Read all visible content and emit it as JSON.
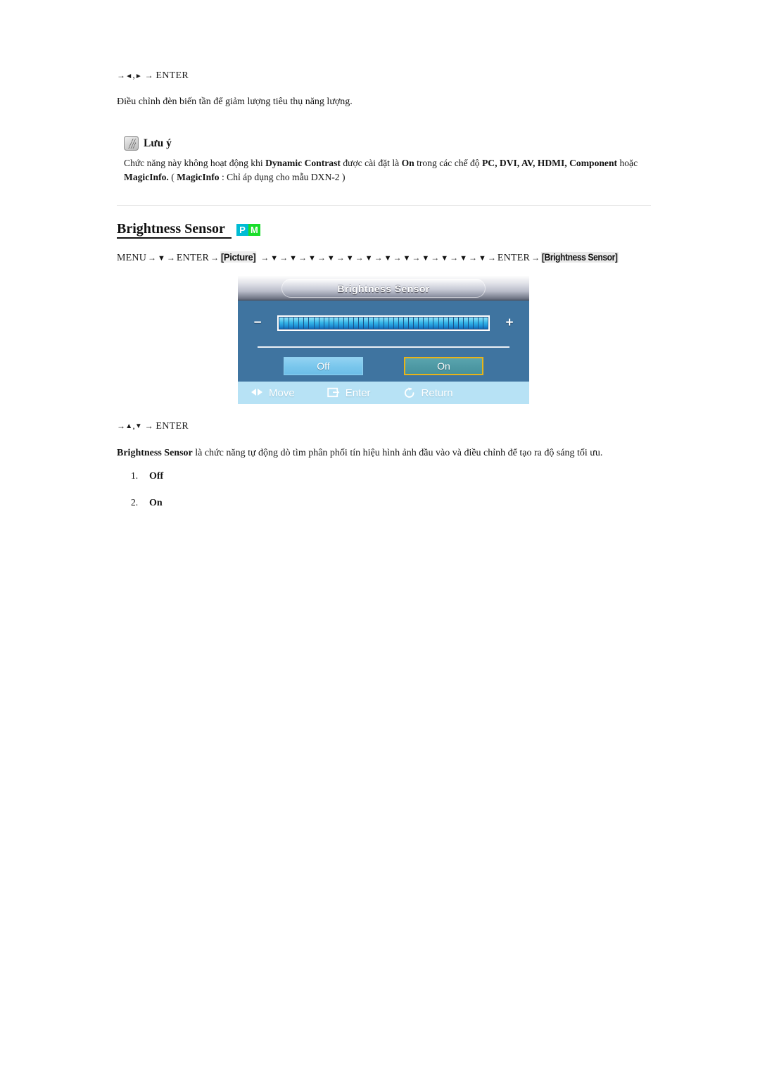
{
  "top_key_sequence": {
    "prefix_arrow": "→",
    "keys": [
      "◄",
      "►"
    ],
    "separator": ",",
    "arrow": "→",
    "enter": "ENTER"
  },
  "intro_paragraph": "Điều chỉnh đèn biến tần để giảm lượng tiêu thụ năng lượng.",
  "note": {
    "icon": "note-pen-icon",
    "title": "Lưu ý",
    "line1_part1": "Chức năng này không hoạt động khi ",
    "line1_bold1": "Dynamic Contrast",
    "line1_part2": " được cài đặt là ",
    "line1_bold2": "On",
    "line1_part3": " trong các chế độ ",
    "line1_bold3": "PC, DVI, AV, HDMI, Component",
    "line1_part4": " hoặc",
    "line2_bold1": "MagicInfo.",
    "line2_part1": " ( ",
    "line2_bold2": "MagicInfo",
    "line2_part2": " : Chỉ áp dụng cho mẫu DXN-2 )"
  },
  "section": {
    "heading": "Brightness Sensor",
    "badges": [
      {
        "label": "P",
        "color": "#00bcd4",
        "name": "badge-picture"
      },
      {
        "label": "M",
        "color": "#19dd2a",
        "name": "badge-magicinfo"
      }
    ]
  },
  "key_path": {
    "menu": "MENU",
    "arrow": "→",
    "down": "▼",
    "enter": "ENTER",
    "picture_chip": "[Picture]",
    "target_chip": "[Brightness Sensor]",
    "downs_before_enter_1": 1,
    "downs_after_picture": 12
  },
  "osd": {
    "title": "Brightness Sensor",
    "minus": "−",
    "plus": "+",
    "slider_segments": 42,
    "slider_fill_percent": 100,
    "buttons": [
      {
        "label": "Off",
        "selected": false,
        "bg": "#79c6ec"
      },
      {
        "label": "On",
        "selected": true,
        "bg": "#4e99a4",
        "border": "#e8b419"
      }
    ],
    "footer": [
      {
        "icon": "move-arrows-icon",
        "label": "Move"
      },
      {
        "icon": "enter-key-icon",
        "label": "Enter"
      },
      {
        "icon": "return-arrow-icon",
        "label": "Return"
      }
    ]
  },
  "bottom_key_sequence": {
    "prefix_arrow": "→",
    "keys": [
      "▲",
      "▼"
    ],
    "separator": ",",
    "arrow": "→",
    "enter": "ENTER"
  },
  "description": {
    "bold_lead": "Brightness Sensor",
    "rest": " là chức năng tự động dò tìm phân phối tín hiệu hình ảnh đầu vào và điều chỉnh để tạo ra độ sáng tối ưu."
  },
  "options_list": [
    {
      "num": "1.",
      "value": "Off"
    },
    {
      "num": "2.",
      "value": "On"
    }
  ]
}
